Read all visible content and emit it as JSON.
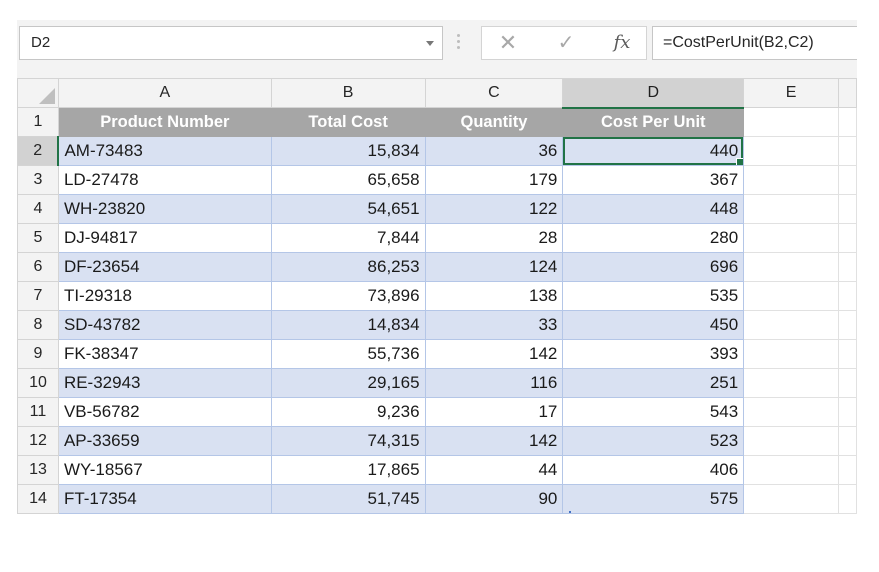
{
  "name_box": {
    "value": "D2"
  },
  "formula_bar": {
    "cancel_icon": "cancel-x-icon",
    "enter_icon": "checkmark-icon",
    "function_icon_label": "fx",
    "formula": "=CostPerUnit(B2,C2)"
  },
  "columns": [
    "A",
    "B",
    "C",
    "D",
    "E"
  ],
  "selected_column": "D",
  "table": {
    "headers": [
      "Product Number",
      "Total Cost",
      "Quantity",
      "Cost Per Unit"
    ],
    "rows": [
      {
        "row": "2",
        "product": "AM-73483",
        "total_cost": "15,834",
        "quantity": "36",
        "cost_per_unit": "440"
      },
      {
        "row": "3",
        "product": "LD-27478",
        "total_cost": "65,658",
        "quantity": "179",
        "cost_per_unit": "367"
      },
      {
        "row": "4",
        "product": "WH-23820",
        "total_cost": "54,651",
        "quantity": "122",
        "cost_per_unit": "448"
      },
      {
        "row": "5",
        "product": "DJ-94817",
        "total_cost": "7,844",
        "quantity": "28",
        "cost_per_unit": "280"
      },
      {
        "row": "6",
        "product": "DF-23654",
        "total_cost": "86,253",
        "quantity": "124",
        "cost_per_unit": "696"
      },
      {
        "row": "7",
        "product": "TI-29318",
        "total_cost": "73,896",
        "quantity": "138",
        "cost_per_unit": "535"
      },
      {
        "row": "8",
        "product": "SD-43782",
        "total_cost": "14,834",
        "quantity": "33",
        "cost_per_unit": "450"
      },
      {
        "row": "9",
        "product": "FK-38347",
        "total_cost": "55,736",
        "quantity": "142",
        "cost_per_unit": "393"
      },
      {
        "row": "10",
        "product": "RE-32943",
        "total_cost": "29,165",
        "quantity": "116",
        "cost_per_unit": "251"
      },
      {
        "row": "11",
        "product": "VB-56782",
        "total_cost": "9,236",
        "quantity": "17",
        "cost_per_unit": "543"
      },
      {
        "row": "12",
        "product": "AP-33659",
        "total_cost": "74,315",
        "quantity": "142",
        "cost_per_unit": "523"
      },
      {
        "row": "13",
        "product": "WY-18567",
        "total_cost": "17,865",
        "quantity": "44",
        "cost_per_unit": "406"
      },
      {
        "row": "14",
        "product": "FT-17354",
        "total_cost": "51,745",
        "quantity": "90",
        "cost_per_unit": "575"
      }
    ]
  },
  "header_row_number": "1",
  "active_cell": "D2",
  "colors": {
    "accent": "#217346",
    "band": "#d9e1f2",
    "header_fill": "#a6a6a6"
  }
}
